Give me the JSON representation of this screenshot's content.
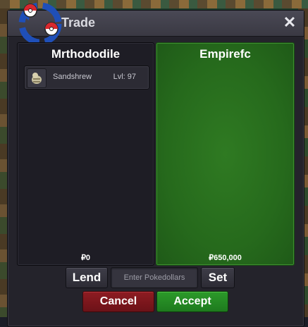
{
  "window": {
    "title": "Trade",
    "close_glyph": "✕"
  },
  "left_panel": {
    "player_name": "Mrthododile",
    "items": [
      {
        "name": "Sandshrew",
        "level": "Lvl: 97",
        "icon": "pokeball-icon"
      }
    ],
    "money": "₽0"
  },
  "right_panel": {
    "player_name": "Empirefc",
    "money": "₽650,000"
  },
  "controls": {
    "lend_label": "Lend",
    "pokedollars_placeholder": "Enter Pokedollars",
    "set_label": "Set",
    "cancel_label": "Cancel",
    "accept_label": "Accept"
  },
  "colors": {
    "accept_panel": "#266a1c",
    "cancel": "#8e1c22",
    "accept": "#1e7a1e"
  }
}
